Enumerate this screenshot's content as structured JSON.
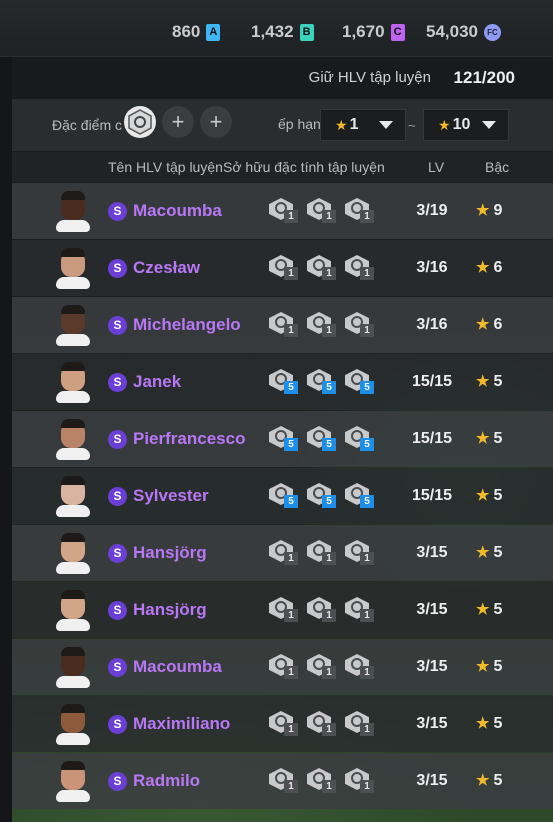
{
  "currencies": [
    {
      "value": "860",
      "icon": "A",
      "color": "#3fb7f4"
    },
    {
      "value": "1,432",
      "icon": "B",
      "color": "#39d3c0"
    },
    {
      "value": "1,670",
      "icon": "C",
      "color": "#c062f2"
    },
    {
      "value": "54,030",
      "icon": "FC",
      "color": "#8e9bf2"
    }
  ],
  "coach_count": {
    "label": "Giữ HLV tập luyện",
    "value": "121/200"
  },
  "filter": {
    "trait_label": "Đặc điểm c",
    "rank_label": "ếp hạng",
    "rank_min": "1",
    "rank_max": "10",
    "separator": "~",
    "add_symbol": "+"
  },
  "columns": {
    "name": "Tên HLV tập luyện",
    "traits": "Sở hữu đặc tính tập luyện",
    "level": "LV",
    "grade": "Bậc"
  },
  "coaches": [
    {
      "name": "Macoumba",
      "skin": "#4a2c1f",
      "level": "3/19",
      "grade": "9",
      "traits": [
        "1",
        "1",
        "1"
      ],
      "maxed": false
    },
    {
      "name": "Czesław",
      "skin": "#c99a7d",
      "level": "3/16",
      "grade": "6",
      "traits": [
        "1",
        "1",
        "1"
      ],
      "maxed": false
    },
    {
      "name": "Michelangelo",
      "skin": "#5a3a2a",
      "level": "3/16",
      "grade": "6",
      "traits": [
        "1",
        "1",
        "1"
      ],
      "maxed": false
    },
    {
      "name": "Janek",
      "skin": "#cf9f82",
      "level": "15/15",
      "grade": "5",
      "traits": [
        "5",
        "5",
        "5"
      ],
      "maxed": true
    },
    {
      "name": "Pierfrancesco",
      "skin": "#b98367",
      "level": "15/15",
      "grade": "5",
      "traits": [
        "5",
        "5",
        "5"
      ],
      "maxed": true
    },
    {
      "name": "Sylvester",
      "skin": "#d9b4a0",
      "level": "15/15",
      "grade": "5",
      "traits": [
        "5",
        "5",
        "5"
      ],
      "maxed": true
    },
    {
      "name": "Hansjörg",
      "skin": "#d2a588",
      "level": "3/15",
      "grade": "5",
      "traits": [
        "1",
        "1",
        "1"
      ],
      "maxed": false
    },
    {
      "name": "Hansjörg",
      "skin": "#d2a588",
      "level": "3/15",
      "grade": "5",
      "traits": [
        "1",
        "1",
        "1"
      ],
      "maxed": false
    },
    {
      "name": "Macoumba",
      "skin": "#4a2c1f",
      "level": "3/15",
      "grade": "5",
      "traits": [
        "1",
        "1",
        "1"
      ],
      "maxed": false
    },
    {
      "name": "Maximiliano",
      "skin": "#8d5a3c",
      "level": "3/15",
      "grade": "5",
      "traits": [
        "1",
        "1",
        "1"
      ],
      "maxed": false
    },
    {
      "name": "Radmilo",
      "skin": "#c99478",
      "level": "3/15",
      "grade": "5",
      "traits": [
        "1",
        "1",
        "1"
      ],
      "maxed": false
    }
  ]
}
